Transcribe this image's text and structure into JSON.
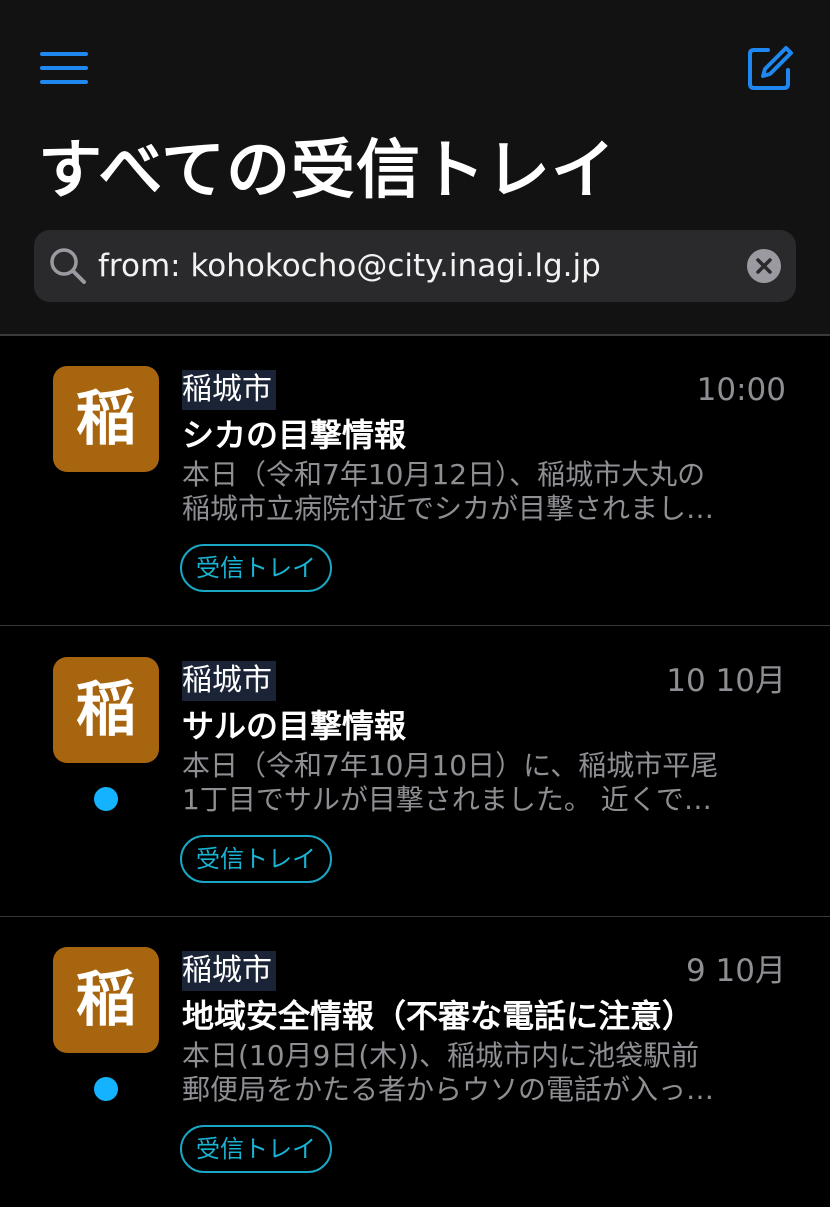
{
  "app": {
    "title": "すべての受信トレイ",
    "accent_color": "#1e88f0",
    "menu_icon": "hamburger-menu-icon",
    "compose_icon": "compose-icon"
  },
  "search": {
    "value": "from: kohokocho@city.inagi.lg.jp",
    "icon": "search-icon",
    "clear_icon": "clear-icon"
  },
  "messages": [
    {
      "avatar_char": "稲",
      "sender": "稲城市",
      "time": "10:00",
      "subject": "シカの目撃情報",
      "preview_line1": "本日（令和7年10月12日）、稲城市大丸の",
      "preview_line2": "稲城市立病院付近でシカが目撃されまし…",
      "tag": "受信トレイ",
      "unread": false
    },
    {
      "avatar_char": "稲",
      "sender": "稲城市",
      "time": "10 10月",
      "subject": "サルの目撃情報",
      "preview_line1": "本日（令和7年10月10日）に、稲城市平尾",
      "preview_line2": "1丁目でサルが目撃されました。 近くで…",
      "tag": "受信トレイ",
      "unread": true
    },
    {
      "avatar_char": "稲",
      "sender": "稲城市",
      "time": "9 10月",
      "subject": "地域安全情報（不審な電話に注意）",
      "preview_line1": "本日(10月9日(木))、稲城市内に池袋駅前",
      "preview_line2": "郵便局をかたる者からウソの電話が入っ…",
      "tag": "受信トレイ",
      "unread": true
    }
  ],
  "colors": {
    "avatar_bg": "#a8650f",
    "unread_dot": "#14b3ff",
    "tag_border": "#19a7c4"
  }
}
